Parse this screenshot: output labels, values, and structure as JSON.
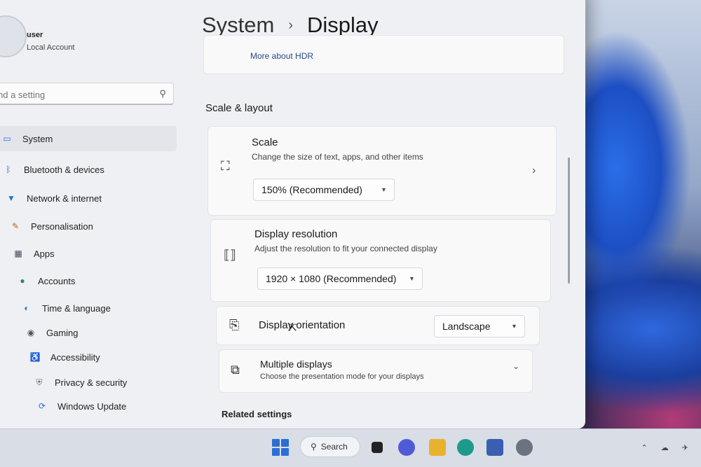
{
  "user": {
    "name": "user",
    "account_type": "Local Account"
  },
  "search": {
    "placeholder": "nd a setting"
  },
  "sidebar": {
    "items": [
      {
        "label": "System",
        "icon": "system-icon",
        "active": true
      },
      {
        "label": "Bluetooth & devices",
        "icon": "bluetooth-icon"
      },
      {
        "label": "Network & internet",
        "icon": "wifi-icon"
      },
      {
        "label": "Personalisation",
        "icon": "brush-icon"
      },
      {
        "label": "Apps",
        "icon": "apps-icon"
      },
      {
        "label": "Accounts",
        "icon": "person-icon"
      },
      {
        "label": "Time & language",
        "icon": "globe-icon"
      },
      {
        "label": "Gaming",
        "icon": "gamepad-icon"
      },
      {
        "label": "Accessibility",
        "icon": "accessibility-icon"
      },
      {
        "label": "Privacy & security",
        "icon": "shield-icon"
      },
      {
        "label": "Windows Update",
        "icon": "update-icon"
      }
    ]
  },
  "breadcrumb": {
    "parent": "System",
    "current": "Display"
  },
  "hdr": {
    "link": "More about HDR"
  },
  "section": {
    "title": "Scale & layout"
  },
  "scale": {
    "title": "Scale",
    "subtitle": "Change the size of text, apps, and other items",
    "value": "150% (Recommended)"
  },
  "resolution": {
    "title": "Display resolution",
    "subtitle": "Adjust the resolution to fit your connected display",
    "value": "1920 × 1080 (Recommended)"
  },
  "orientation": {
    "title": "Display orientation",
    "value": "Landscape"
  },
  "multiple": {
    "title": "Multiple displays",
    "subtitle": "Choose the presentation mode for your displays"
  },
  "related": {
    "title": "Related settings"
  },
  "taskbar": {
    "search_label": "Search"
  },
  "colors": {
    "accent": "#2b6fd6",
    "window_bg": "#eef0f3"
  }
}
